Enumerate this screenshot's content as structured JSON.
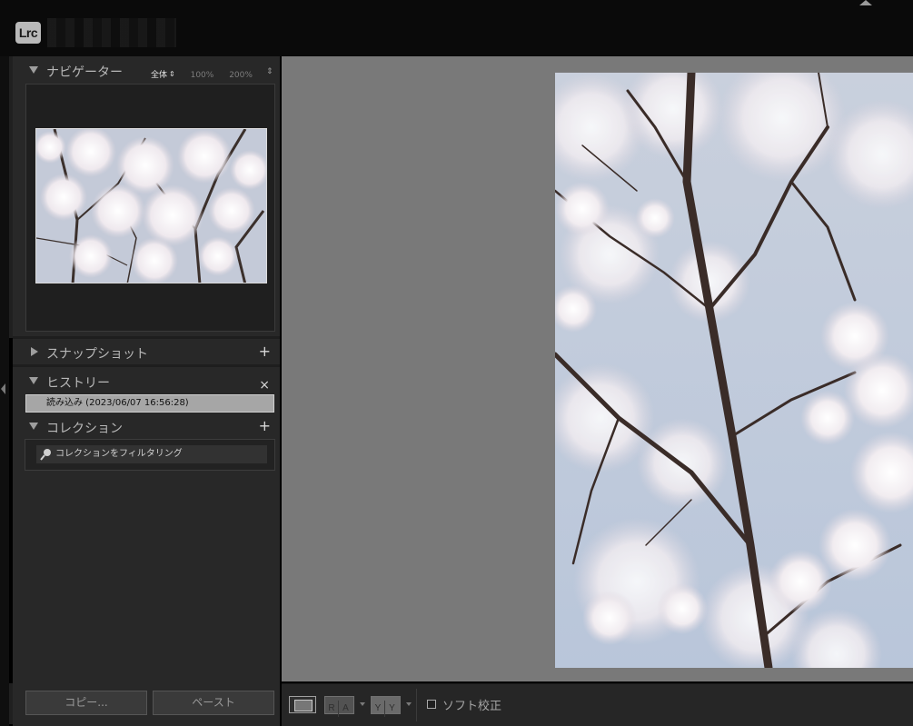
{
  "app": {
    "logo": "Lrc"
  },
  "icons": {
    "collapse": "triangle-down-icon",
    "expand": "triangle-right-icon",
    "add": "plus-icon",
    "close": "close-icon",
    "search": "search-icon"
  },
  "colors": {
    "panel_bg": "#282828",
    "main_bg": "#797979",
    "history_selected": "#a6a6a6"
  },
  "navigator": {
    "title": "ナビゲーター",
    "zoom_options": [
      "全体",
      "100%",
      "200%"
    ],
    "selected_zoom": "全体"
  },
  "snapshots": {
    "title": "スナップショット",
    "add_symbol": "+"
  },
  "history": {
    "title": "ヒストリー",
    "close_symbol": "×",
    "items": [
      "読み込み (2023/06/07 16:56:28)"
    ]
  },
  "collections": {
    "title": "コレクション",
    "add_symbol": "+",
    "filter_placeholder": "コレクションをフィルタリング"
  },
  "footer": {
    "copy_label": "コピー...",
    "paste_label": "ペースト"
  },
  "toolbar": {
    "before_after_1": [
      "R",
      "A"
    ],
    "before_after_2": [
      "Y",
      "Y"
    ],
    "soft_proof_label": "ソフト校正",
    "soft_proof_checked": false
  }
}
